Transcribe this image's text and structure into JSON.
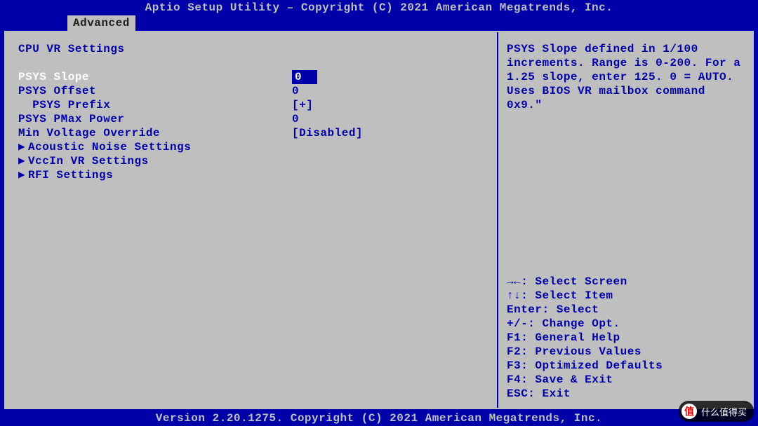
{
  "header": {
    "title": "Aptio Setup Utility – Copyright (C) 2021 American Megatrends, Inc."
  },
  "tabs": {
    "active": "Advanced"
  },
  "main": {
    "section_title": "CPU VR Settings",
    "rows": [
      {
        "label": "PSYS Slope",
        "value": "0",
        "selected": true
      },
      {
        "label": "PSYS Offset",
        "value": "0"
      },
      {
        "label": "  PSYS Prefix",
        "value": "[+]"
      },
      {
        "label": "PSYS PMax Power",
        "value": "0"
      },
      {
        "label": "Min Voltage Override",
        "value": "[Disabled]"
      }
    ],
    "submenus": [
      "Acoustic Noise Settings",
      "VccIn VR Settings",
      "RFI Settings"
    ]
  },
  "help": {
    "text": "PSYS Slope defined in 1/100 increments. Range is 0-200. For a 1.25 slope, enter 125. 0 = AUTO. Uses BIOS VR mailbox command 0x9.\""
  },
  "keys": {
    "lines": [
      "→←: Select Screen",
      "↑↓: Select Item",
      "Enter: Select",
      "+/-: Change Opt.",
      "F1: General Help",
      "F2: Previous Values",
      "F3: Optimized Defaults",
      "F4: Save & Exit",
      "ESC: Exit"
    ]
  },
  "footer": {
    "text": "Version 2.20.1275. Copyright (C) 2021 American Megatrends, Inc."
  },
  "watermark": {
    "badge": "值",
    "text": "什么值得买"
  }
}
